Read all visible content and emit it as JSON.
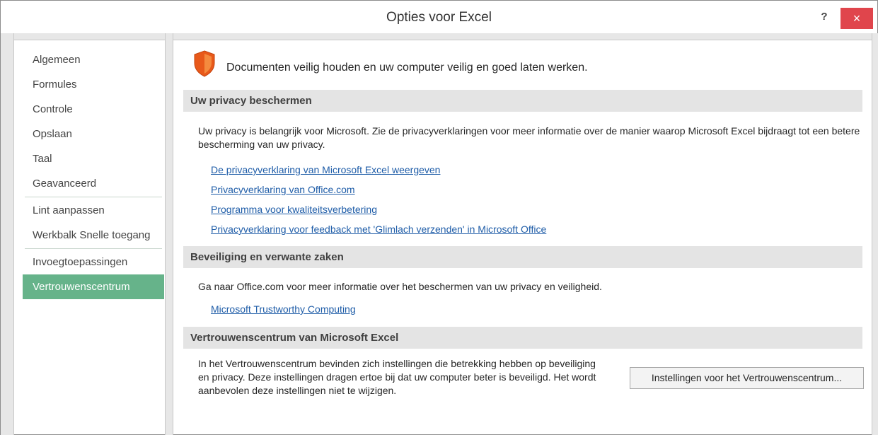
{
  "window": {
    "title": "Opties voor Excel",
    "help_label": "?",
    "close_label": "×"
  },
  "sidebar": {
    "items": [
      {
        "label": "Algemeen"
      },
      {
        "label": "Formules"
      },
      {
        "label": "Controle"
      },
      {
        "label": "Opslaan"
      },
      {
        "label": "Taal"
      },
      {
        "label": "Geavanceerd"
      },
      {
        "label": "Lint aanpassen"
      },
      {
        "label": "Werkbalk Snelle toegang"
      },
      {
        "label": "Invoegtoepassingen"
      },
      {
        "label": "Vertrouwenscentrum"
      }
    ],
    "selected": "Vertrouwenscentrum"
  },
  "main": {
    "intro": {
      "icon": "shield-icon",
      "text": "Documenten veilig houden en uw computer veilig en goed laten werken."
    },
    "privacy": {
      "header": "Uw privacy beschermen",
      "text": "Uw privacy is belangrijk voor Microsoft. Zie de privacyverklaringen voor meer informatie over de manier waarop Microsoft Excel bijdraagt tot een betere bescherming van uw privacy.",
      "links": [
        "De privacyverklaring van Microsoft Excel weergeven",
        "Privacyverklaring van Office.com",
        "Programma voor kwaliteitsverbetering",
        "Privacyverklaring voor feedback met 'Glimlach verzenden' in Microsoft Office"
      ]
    },
    "security": {
      "header": "Beveiliging en verwante zaken",
      "text": "Ga naar Office.com voor meer informatie over het beschermen van uw privacy en veiligheid.",
      "link": "Microsoft Trustworthy Computing"
    },
    "trust_center": {
      "header": "Vertrouwenscentrum van Microsoft Excel",
      "text": "In het Vertrouwenscentrum bevinden zich instellingen die betrekking hebben op beveiliging en privacy. Deze instellingen dragen ertoe bij dat uw computer beter is beveiligd. Het wordt aanbevolen deze instellingen niet te wijzigen.",
      "button_label": "Instellingen voor het Vertrouwenscentrum..."
    }
  },
  "colors": {
    "accent": "#66b38a",
    "link": "#1f5da8",
    "close": "#e0454c",
    "shield": "#e8591a"
  }
}
